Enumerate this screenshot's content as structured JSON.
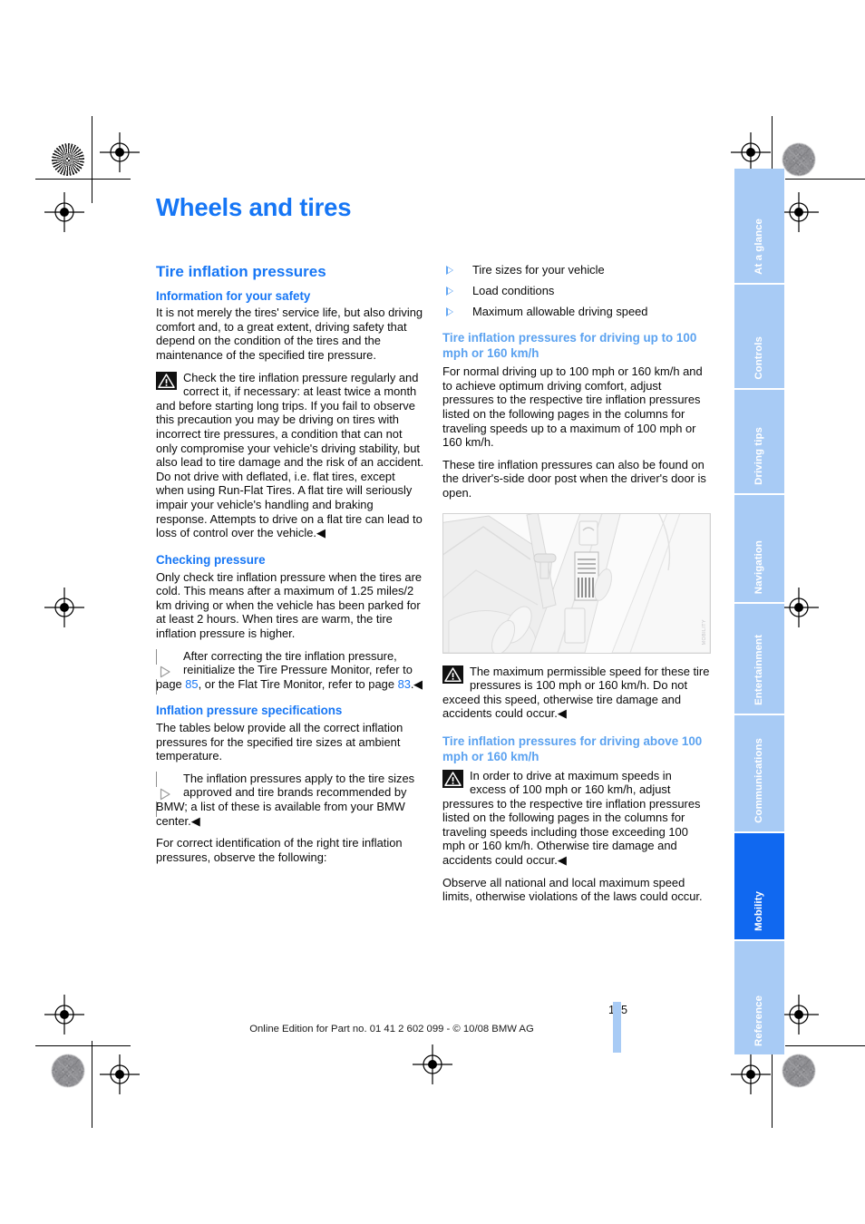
{
  "document": {
    "chapter_title": "Wheels and tires",
    "page_number": "195",
    "imprint": "Online Edition for Part no. 01 41 2 602 099 - © 10/08 BMW AG"
  },
  "colors": {
    "heading_blue": "#1676f5",
    "subheading_light_blue": "#5ba2f0",
    "tab_blue": "#a8cbf5",
    "tab_active_blue": "#1068f0",
    "link_blue": "#1676f5"
  },
  "left_column": {
    "section_heading": "Tire inflation pressures",
    "sub1": {
      "heading": "Information for your safety",
      "para1": "It is not merely the tires' service life, but also driving comfort and, to a great extent, driving safety that depend on the condition of the tires and the maintenance of the specified tire pressure.",
      "warning": "Check the tire inflation pressure regularly and correct it, if necessary: at least twice a month and before starting long trips. If you fail to observe this precaution you may be driving on tires with incorrect tire pressures, a condition that can not only compromise your vehicle's driving stability, but also lead to tire damage and the risk of an accident. Do not drive with deflated, i.e. flat tires, except when using Run-Flat Tires. A flat tire will seriously impair your vehicle's handling and braking response. Attempts to drive on a flat tire can lead to loss of control over the vehicle.◀"
    },
    "sub2": {
      "heading": "Checking pressure",
      "para1": "Only check tire inflation pressure when the tires are cold. This means after a maximum of 1.25 miles/2 km driving or when the vehicle has been parked for at least 2 hours. When tires are warm, the tire inflation pressure is higher.",
      "note_part1": "After correcting the tire inflation pressure, reinitialize the Tire Pressure Monitor, refer to page ",
      "note_link1": "85",
      "note_part2": ", or the Flat Tire Monitor, refer to page ",
      "note_link2": "83",
      "note_part3": ".◀"
    },
    "sub3": {
      "heading": "Inflation pressure specifications",
      "para1": "The tables below provide all the correct inflation pressures for the specified tire sizes at ambient temperature.",
      "note": "The inflation pressures apply to the tire sizes approved and tire brands recommended by BMW; a list of these is available from your BMW center.◀",
      "para2": "For correct identification of the right tire inflation pressures, observe the following:"
    }
  },
  "right_column": {
    "bullets": [
      "Tire sizes for your vehicle",
      "Load conditions",
      "Maximum allowable driving speed"
    ],
    "sub1": {
      "heading": "Tire inflation pressures for driving up to 100 mph or 160 km/h",
      "para1": "For normal driving up to 100 mph or 160 km/h and to achieve optimum driving comfort, adjust pressures to the respective tire inflation pressures listed on the following pages in the columns for traveling speeds up to a maximum of 100 mph or 160 km/h.",
      "para2": "These tire inflation pressures can also be found on the driver's-side door post when the driver's door is open.",
      "figure_caption_code": "MOBILITY",
      "warning": "The maximum permissible speed for these tire pressures is 100 mph or 160 km/h. Do not exceed this speed, otherwise tire damage and accidents could occur.◀"
    },
    "sub2": {
      "heading": "Tire inflation pressures for driving above 100 mph or 160 km/h",
      "warning": "In order to drive at maximum speeds in excess of 100 mph or 160 km/h, adjust pressures to the respective tire inflation pressures listed on the following pages in the columns for traveling speeds including those exceeding 100 mph or 160 km/h. Otherwise tire damage and accidents could occur.◀",
      "para1": "Observe all national and local maximum speed limits, otherwise violations of the laws could occur."
    }
  },
  "tabs": [
    {
      "label": "At a glance",
      "active": false
    },
    {
      "label": "Controls",
      "active": false
    },
    {
      "label": "Driving tips",
      "active": false
    },
    {
      "label": "Navigation",
      "active": false
    },
    {
      "label": "Entertainment",
      "active": false
    },
    {
      "label": "Communications",
      "active": false
    },
    {
      "label": "Mobility",
      "active": true
    },
    {
      "label": "Reference",
      "active": false
    }
  ]
}
